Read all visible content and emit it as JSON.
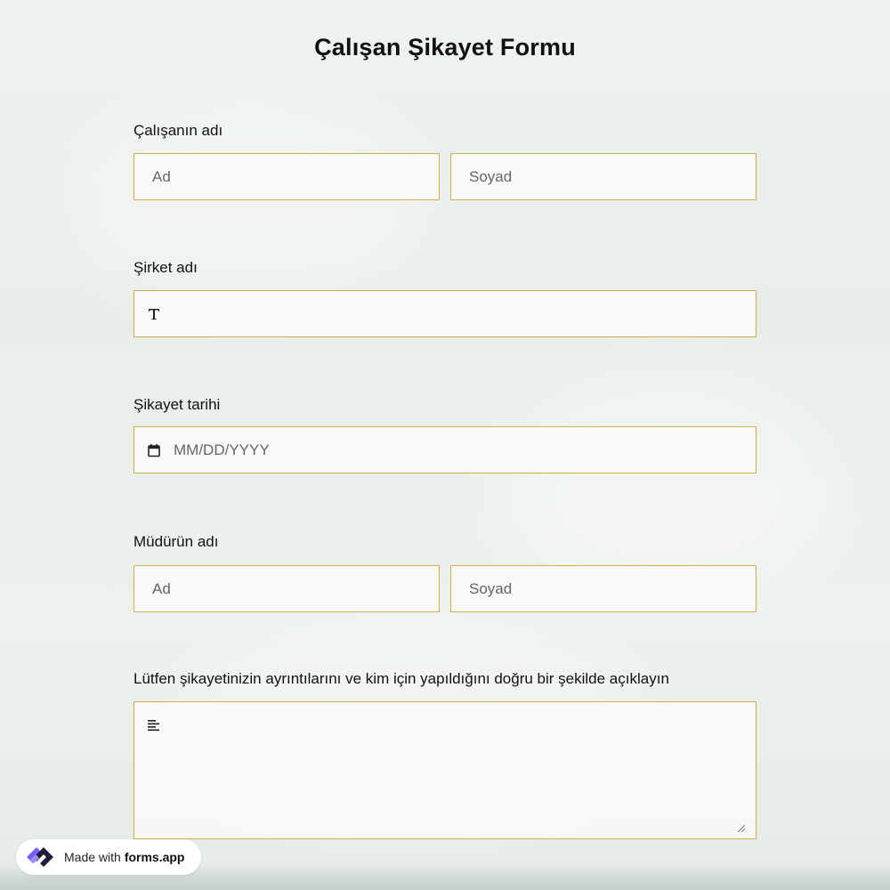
{
  "form": {
    "title": "Çalışan Şikayet Formu",
    "employee_name": {
      "label": "Çalışanın adı",
      "first_placeholder": "Ad",
      "last_placeholder": "Soyad"
    },
    "company_name": {
      "label": "Şirket adı",
      "icon": "text-type-icon"
    },
    "complaint_date": {
      "label": "Şikayet tarihi",
      "placeholder": "MM/DD/YYYY",
      "icon": "calendar-icon"
    },
    "manager_name": {
      "label": "Müdürün adı",
      "first_placeholder": "Ad",
      "last_placeholder": "Soyad"
    },
    "details": {
      "label": "Lütfen şikayetinizin ayrıntılarını ve kim için yapıldığını doğru bir şekilde açıklayın",
      "icon": "align-left-icon"
    }
  },
  "badge": {
    "made_with": "Made with",
    "brand": "forms.app",
    "icon": "forms-app-logo-icon"
  },
  "colors": {
    "field_border": "#d9ad4e",
    "logo_purple": "#7b5cf0",
    "logo_dark": "#1f1d3a"
  }
}
